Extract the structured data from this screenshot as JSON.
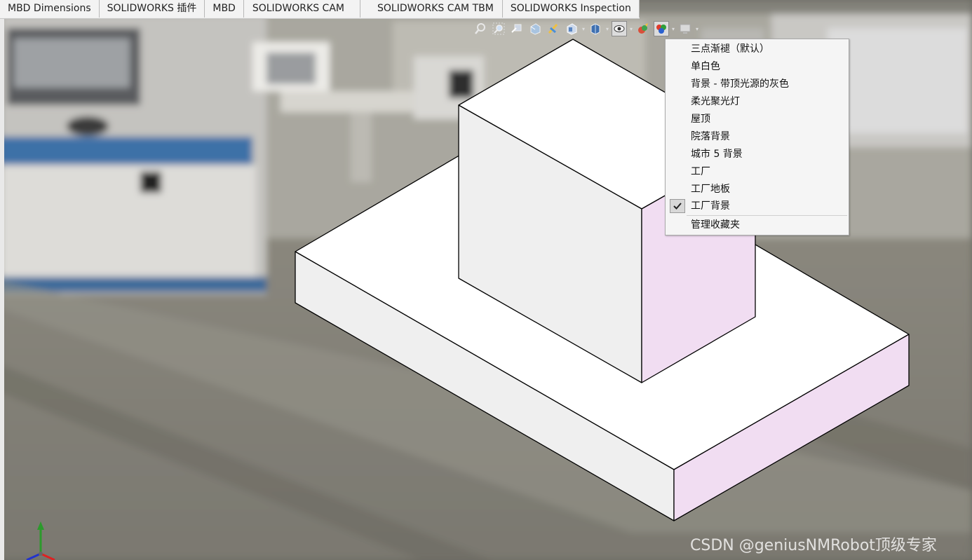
{
  "tabs": [
    {
      "label": "MBD Dimensions"
    },
    {
      "label": "SOLIDWORKS 插件"
    },
    {
      "label": "MBD"
    },
    {
      "label": "SOLIDWORKS CAM"
    },
    {
      "label": "SOLIDWORKS CAM TBM"
    },
    {
      "label": "SOLIDWORKS Inspection"
    }
  ],
  "hud": {
    "icons": [
      "zoom-to-fit-icon",
      "zoom-area-icon",
      "previous-view-icon",
      "section-view-icon",
      "dynamic-annotation-icon",
      "view-orientation-icon",
      "display-style-icon",
      "hide-show-items-icon",
      "edit-appearance-icon",
      "apply-scene-icon",
      "view-settings-icon"
    ]
  },
  "scene_menu": {
    "items": [
      {
        "label": "三点渐褪（默认）",
        "checked": false
      },
      {
        "label": "单白色",
        "checked": false
      },
      {
        "label": "背景 - 带顶光源的灰色",
        "checked": false
      },
      {
        "label": "柔光聚光灯",
        "checked": false
      },
      {
        "label": "屋顶",
        "checked": false
      },
      {
        "label": "院落背景",
        "checked": false
      },
      {
        "label": "城市 5 背景",
        "checked": false
      },
      {
        "label": "工厂",
        "checked": false
      },
      {
        "label": "工厂地板",
        "checked": false
      },
      {
        "label": "工厂背景",
        "checked": true
      }
    ],
    "manage_label": "管理收藏夹"
  },
  "watermark": "CSDN @geniusNMRobot顶级专家",
  "colors": {
    "face_top": "#ffffff",
    "face_left": "#efefef",
    "face_right": "#f1ddf2",
    "edge": "#000000"
  }
}
